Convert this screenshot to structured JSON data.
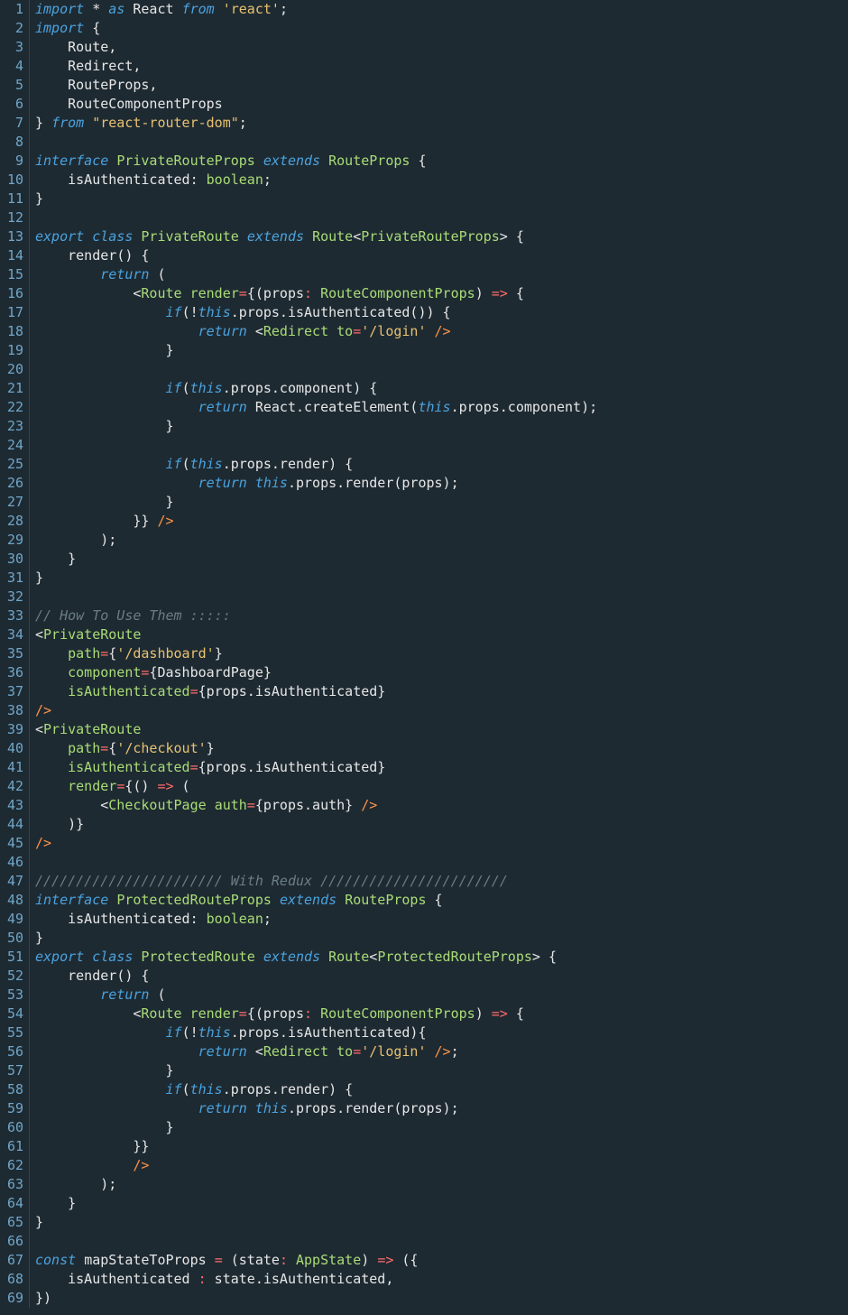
{
  "lineStart": 1,
  "lines": [
    [
      [
        "kw",
        "import"
      ],
      [
        "ident",
        " * "
      ],
      [
        "kw",
        "as"
      ],
      [
        "ident",
        " React "
      ],
      [
        "kw",
        "from"
      ],
      [
        "ident",
        " "
      ],
      [
        "str",
        "'react'"
      ],
      [
        "punc",
        ";"
      ]
    ],
    [
      [
        "kw",
        "import"
      ],
      [
        "ident",
        " {"
      ]
    ],
    [
      [
        "ident",
        "    Route,"
      ]
    ],
    [
      [
        "ident",
        "    Redirect,"
      ]
    ],
    [
      [
        "ident",
        "    RouteProps,"
      ]
    ],
    [
      [
        "ident",
        "    RouteComponentProps"
      ]
    ],
    [
      [
        "ident",
        "} "
      ],
      [
        "kw",
        "from"
      ],
      [
        "ident",
        " "
      ],
      [
        "str",
        "\"react-router-dom\""
      ],
      [
        "punc",
        ";"
      ]
    ],
    [],
    [
      [
        "kw",
        "interface"
      ],
      [
        "ident",
        " "
      ],
      [
        "type",
        "PrivateRouteProps"
      ],
      [
        "ident",
        " "
      ],
      [
        "kw",
        "extends"
      ],
      [
        "ident",
        " "
      ],
      [
        "type",
        "RouteProps"
      ],
      [
        "ident",
        " {"
      ]
    ],
    [
      [
        "ident",
        "    isAuthenticated: "
      ],
      [
        "type",
        "boolean"
      ],
      [
        "punc",
        ";"
      ]
    ],
    [
      [
        "ident",
        "}"
      ]
    ],
    [],
    [
      [
        "kw",
        "export"
      ],
      [
        "ident",
        " "
      ],
      [
        "kw",
        "class"
      ],
      [
        "ident",
        " "
      ],
      [
        "type",
        "PrivateRoute"
      ],
      [
        "ident",
        " "
      ],
      [
        "kw",
        "extends"
      ],
      [
        "ident",
        " "
      ],
      [
        "type",
        "Route"
      ],
      [
        "angle",
        "<"
      ],
      [
        "type",
        "PrivateRouteProps"
      ],
      [
        "angle",
        ">"
      ],
      [
        "ident",
        " {"
      ]
    ],
    [
      [
        "ident",
        "    "
      ],
      [
        "fn",
        "render"
      ],
      [
        "ident",
        "() {"
      ]
    ],
    [
      [
        "ident",
        "        "
      ],
      [
        "kw",
        "return"
      ],
      [
        "ident",
        " ("
      ]
    ],
    [
      [
        "ident",
        "            <"
      ],
      [
        "type",
        "Route"
      ],
      [
        "ident",
        " "
      ],
      [
        "prop",
        "render"
      ],
      [
        "op",
        "="
      ],
      [
        "ident",
        "{("
      ],
      [
        "ident",
        "props"
      ],
      [
        "op",
        ":"
      ],
      [
        "ident",
        " "
      ],
      [
        "type",
        "RouteComponentProps"
      ],
      [
        "ident",
        ") "
      ],
      [
        "op",
        "=>"
      ],
      [
        "ident",
        " {"
      ]
    ],
    [
      [
        "ident",
        "                "
      ],
      [
        "kw",
        "if"
      ],
      [
        "ident",
        "(!"
      ],
      [
        "this",
        "this"
      ],
      [
        "ident",
        ".props.isAuthenticated()) {"
      ]
    ],
    [
      [
        "ident",
        "                    "
      ],
      [
        "kw",
        "return"
      ],
      [
        "ident",
        " <"
      ],
      [
        "type",
        "Redirect"
      ],
      [
        "ident",
        " "
      ],
      [
        "prop",
        "to"
      ],
      [
        "op",
        "="
      ],
      [
        "str",
        "'/login'"
      ],
      [
        "ident",
        " "
      ],
      [
        "tag",
        "/>"
      ]
    ],
    [
      [
        "ident",
        "                }"
      ]
    ],
    [],
    [
      [
        "ident",
        "                "
      ],
      [
        "kw",
        "if"
      ],
      [
        "ident",
        "("
      ],
      [
        "this",
        "this"
      ],
      [
        "ident",
        ".props.component) {"
      ]
    ],
    [
      [
        "ident",
        "                    "
      ],
      [
        "kw",
        "return"
      ],
      [
        "ident",
        " React.createElement("
      ],
      [
        "this",
        "this"
      ],
      [
        "ident",
        ".props.component);"
      ]
    ],
    [
      [
        "ident",
        "                }"
      ]
    ],
    [],
    [
      [
        "ident",
        "                "
      ],
      [
        "kw",
        "if"
      ],
      [
        "ident",
        "("
      ],
      [
        "this",
        "this"
      ],
      [
        "ident",
        ".props.render) {"
      ]
    ],
    [
      [
        "ident",
        "                    "
      ],
      [
        "kw",
        "return"
      ],
      [
        "ident",
        " "
      ],
      [
        "this",
        "this"
      ],
      [
        "ident",
        ".props.render(props);"
      ]
    ],
    [
      [
        "ident",
        "                }"
      ]
    ],
    [
      [
        "ident",
        "            }} "
      ],
      [
        "tag",
        "/>"
      ]
    ],
    [
      [
        "ident",
        "        );"
      ]
    ],
    [
      [
        "ident",
        "    }"
      ]
    ],
    [
      [
        "ident",
        "}"
      ]
    ],
    [],
    [
      [
        "cmnt",
        "// How To Use Them :::::"
      ]
    ],
    [
      [
        "ident",
        "<"
      ],
      [
        "type",
        "PrivateRoute"
      ]
    ],
    [
      [
        "ident",
        "    "
      ],
      [
        "prop",
        "path"
      ],
      [
        "op",
        "="
      ],
      [
        "ident",
        "{"
      ],
      [
        "str",
        "'/dashboard'"
      ],
      [
        "ident",
        "}"
      ]
    ],
    [
      [
        "ident",
        "    "
      ],
      [
        "prop",
        "component"
      ],
      [
        "op",
        "="
      ],
      [
        "ident",
        "{DashboardPage}"
      ]
    ],
    [
      [
        "ident",
        "    "
      ],
      [
        "prop",
        "isAuthenticated"
      ],
      [
        "op",
        "="
      ],
      [
        "ident",
        "{props.isAuthenticated}"
      ]
    ],
    [
      [
        "tag",
        "/>"
      ]
    ],
    [
      [
        "ident",
        "<"
      ],
      [
        "type",
        "PrivateRoute"
      ]
    ],
    [
      [
        "ident",
        "    "
      ],
      [
        "prop",
        "path"
      ],
      [
        "op",
        "="
      ],
      [
        "ident",
        "{"
      ],
      [
        "str",
        "'/checkout'"
      ],
      [
        "ident",
        "}"
      ]
    ],
    [
      [
        "ident",
        "    "
      ],
      [
        "prop",
        "isAuthenticated"
      ],
      [
        "op",
        "="
      ],
      [
        "ident",
        "{props.isAuthenticated}"
      ]
    ],
    [
      [
        "ident",
        "    "
      ],
      [
        "prop",
        "render"
      ],
      [
        "op",
        "="
      ],
      [
        "ident",
        "{() "
      ],
      [
        "op",
        "=>"
      ],
      [
        "ident",
        " ("
      ]
    ],
    [
      [
        "ident",
        "        <"
      ],
      [
        "type",
        "CheckoutPage"
      ],
      [
        "ident",
        " "
      ],
      [
        "prop",
        "auth"
      ],
      [
        "op",
        "="
      ],
      [
        "ident",
        "{props.auth} "
      ],
      [
        "tag",
        "/>"
      ]
    ],
    [
      [
        "ident",
        "    )}"
      ]
    ],
    [
      [
        "tag",
        "/>"
      ]
    ],
    [],
    [
      [
        "cmnt",
        "/////////////////////// With Redux ///////////////////////"
      ]
    ],
    [
      [
        "kw",
        "interface"
      ],
      [
        "ident",
        " "
      ],
      [
        "type",
        "ProtectedRouteProps"
      ],
      [
        "ident",
        " "
      ],
      [
        "kw",
        "extends"
      ],
      [
        "ident",
        " "
      ],
      [
        "type",
        "RouteProps"
      ],
      [
        "ident",
        " {"
      ]
    ],
    [
      [
        "ident",
        "    isAuthenticated: "
      ],
      [
        "type",
        "boolean"
      ],
      [
        "punc",
        ";"
      ]
    ],
    [
      [
        "ident",
        "}"
      ]
    ],
    [
      [
        "kw",
        "export"
      ],
      [
        "ident",
        " "
      ],
      [
        "kw",
        "class"
      ],
      [
        "ident",
        " "
      ],
      [
        "type",
        "ProtectedRoute"
      ],
      [
        "ident",
        " "
      ],
      [
        "kw",
        "extends"
      ],
      [
        "ident",
        " "
      ],
      [
        "type",
        "Route"
      ],
      [
        "angle",
        "<"
      ],
      [
        "type",
        "ProtectedRouteProps"
      ],
      [
        "angle",
        ">"
      ],
      [
        "ident",
        " {"
      ]
    ],
    [
      [
        "ident",
        "    "
      ],
      [
        "fn",
        "render"
      ],
      [
        "ident",
        "() {"
      ]
    ],
    [
      [
        "ident",
        "        "
      ],
      [
        "kw",
        "return"
      ],
      [
        "ident",
        " ("
      ]
    ],
    [
      [
        "ident",
        "            <"
      ],
      [
        "type",
        "Route"
      ],
      [
        "ident",
        " "
      ],
      [
        "prop",
        "render"
      ],
      [
        "op",
        "="
      ],
      [
        "ident",
        "{("
      ],
      [
        "ident",
        "props"
      ],
      [
        "op",
        ":"
      ],
      [
        "ident",
        " "
      ],
      [
        "type",
        "RouteComponentProps"
      ],
      [
        "ident",
        ") "
      ],
      [
        "op",
        "=>"
      ],
      [
        "ident",
        " {"
      ]
    ],
    [
      [
        "ident",
        "                "
      ],
      [
        "kw",
        "if"
      ],
      [
        "ident",
        "(!"
      ],
      [
        "this",
        "this"
      ],
      [
        "ident",
        ".props.isAuthenticated){"
      ]
    ],
    [
      [
        "ident",
        "                    "
      ],
      [
        "kw",
        "return"
      ],
      [
        "ident",
        " <"
      ],
      [
        "type",
        "Redirect"
      ],
      [
        "ident",
        " "
      ],
      [
        "prop",
        "to"
      ],
      [
        "op",
        "="
      ],
      [
        "str",
        "'/login'"
      ],
      [
        "ident",
        " "
      ],
      [
        "tag",
        "/>"
      ],
      [
        "punc",
        ";"
      ]
    ],
    [
      [
        "ident",
        "                }"
      ]
    ],
    [
      [
        "ident",
        "                "
      ],
      [
        "kw",
        "if"
      ],
      [
        "ident",
        "("
      ],
      [
        "this",
        "this"
      ],
      [
        "ident",
        ".props.render) {"
      ]
    ],
    [
      [
        "ident",
        "                    "
      ],
      [
        "kw",
        "return"
      ],
      [
        "ident",
        " "
      ],
      [
        "this",
        "this"
      ],
      [
        "ident",
        ".props.render(props);"
      ]
    ],
    [
      [
        "ident",
        "                }"
      ]
    ],
    [
      [
        "ident",
        "            }}"
      ]
    ],
    [
      [
        "ident",
        "            "
      ],
      [
        "tag",
        "/>"
      ]
    ],
    [
      [
        "ident",
        "        );"
      ]
    ],
    [
      [
        "ident",
        "    }"
      ]
    ],
    [
      [
        "ident",
        "}"
      ]
    ],
    [],
    [
      [
        "kw",
        "const"
      ],
      [
        "ident",
        " "
      ],
      [
        "fn",
        "mapStateToProps"
      ],
      [
        "ident",
        " "
      ],
      [
        "op",
        "="
      ],
      [
        "ident",
        " (state"
      ],
      [
        "op",
        ":"
      ],
      [
        "ident",
        " "
      ],
      [
        "type",
        "AppState"
      ],
      [
        "ident",
        ") "
      ],
      [
        "op",
        "=>"
      ],
      [
        "ident",
        " ({"
      ]
    ],
    [
      [
        "ident",
        "    isAuthenticated "
      ],
      [
        "op",
        ":"
      ],
      [
        "ident",
        " state.isAuthenticated,"
      ]
    ],
    [
      [
        "ident",
        "})"
      ]
    ]
  ]
}
